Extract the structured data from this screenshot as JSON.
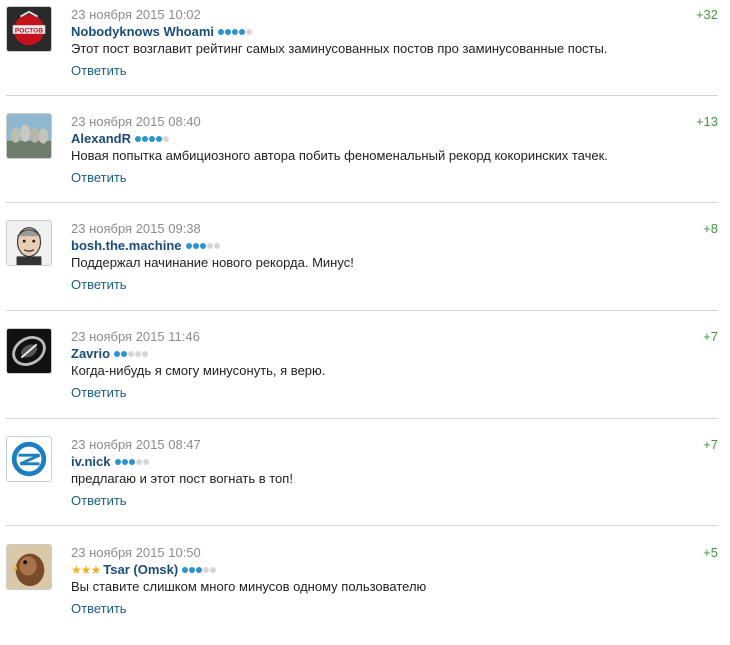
{
  "comments": [
    {
      "date": "23 ноября 2015 10:02",
      "user": "Nobodyknows Whoami",
      "rank": 4,
      "stars": "",
      "text": "Этот пост возглавит рейтинг самых заминусованных постов про заминусованные посты.",
      "reply": "Ответить",
      "score": "+32",
      "avatar": "club-logo-icon"
    },
    {
      "date": "23 ноября 2015 08:40",
      "user": "AlexandR",
      "rank": 4,
      "stars": "",
      "text": "Новая попытка амбициозного автора побить феноменальный рекорд кокоринских тачек.",
      "reply": "Ответить",
      "score": "+13",
      "avatar": "rushmore-icon"
    },
    {
      "date": "23 ноября 2015 09:38",
      "user": "bosh.the.machine",
      "rank": 3,
      "stars": "",
      "text": "Поддержал начинание нового рекорда. Минус!",
      "reply": "Ответить",
      "score": "+8",
      "avatar": "cartoon-face-icon"
    },
    {
      "date": "23 ноября 2015 11:46",
      "user": "Zavrio",
      "rank": 2,
      "stars": "",
      "text": "Когда-нибудь я смогу минусонуть, я верю.",
      "reply": "Ответить",
      "score": "+7",
      "avatar": "juventus-logo-icon"
    },
    {
      "date": "23 ноября 2015 08:47",
      "user": "iv.nick",
      "rank": 3,
      "stars": "",
      "text": "предлагаю и этот пост вогнать в топ!",
      "reply": "Ответить",
      "score": "+7",
      "avatar": "zenit-logo-icon"
    },
    {
      "date": "23 ноября 2015 10:50",
      "user": "Tsar (Omsk)",
      "rank": 3,
      "stars": "★★★",
      "text": "Вы ставите слишком много минусов одному пользователю",
      "reply": "Ответить",
      "score": "+5",
      "avatar": "hawk-icon"
    }
  ],
  "colors": {
    "username": "#1a4c7a",
    "score": "#3e9a3e",
    "rank_on": "#2b93d0",
    "rank_off": "#d6d6d6",
    "stars": "#f2b01e"
  }
}
